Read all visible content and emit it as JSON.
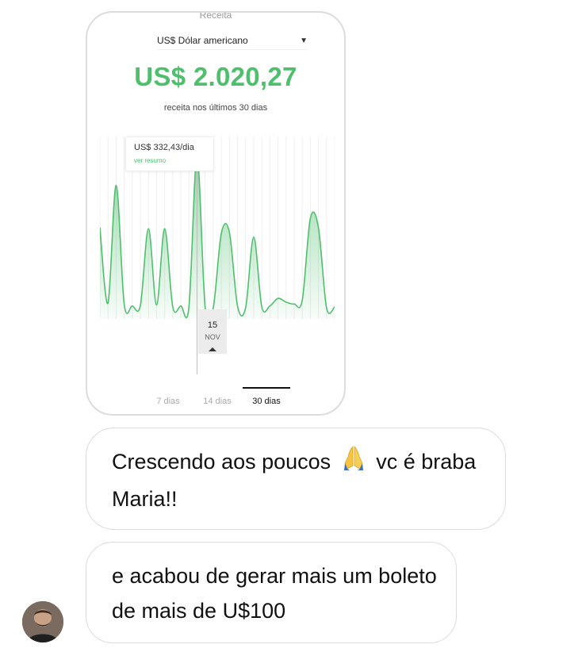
{
  "card": {
    "label": "Receita",
    "currency_select": "US$ Dólar americano",
    "caret_icon": "caret-down-icon",
    "amount": "US$ 2.020,27",
    "subtitle": "receita nos últimos 30 dias",
    "tooltip": {
      "value": "US$ 332,43/dia",
      "link": "ver resumo"
    },
    "selected_date": {
      "day": "15",
      "month": "NOV"
    },
    "tabs": [
      "7 dias",
      "14 dias",
      "30 dias"
    ],
    "active_tab": "30 dias",
    "accent_color": "#4fbf6e"
  },
  "chart_data": {
    "type": "area",
    "x": [
      1,
      2,
      3,
      4,
      5,
      6,
      7,
      8,
      9,
      10,
      11,
      12,
      13,
      14,
      15,
      16,
      17,
      18,
      19,
      20,
      21,
      22,
      23,
      24,
      25,
      26,
      27,
      28,
      29,
      30
    ],
    "values": [
      180,
      20,
      270,
      18,
      14,
      15,
      178,
      16,
      178,
      12,
      14,
      12,
      332,
      12,
      10,
      168,
      170,
      14,
      10,
      160,
      12,
      14,
      30,
      22,
      18,
      26,
      200,
      180,
      10,
      12
    ],
    "highlight_index": 12,
    "highlight_label": "US$ 332,43/dia",
    "series_color": "#4fbf6e",
    "xlabel": "",
    "ylabel": ""
  },
  "messages": [
    {
      "text_before": "Crescendo aos poucos",
      "emoji": "🙏",
      "text_after": "vc é braba Maria!!"
    },
    {
      "text": "e acabou de gerar mais um boleto de mais de U$100"
    }
  ],
  "avatar_icon": "profile-avatar"
}
